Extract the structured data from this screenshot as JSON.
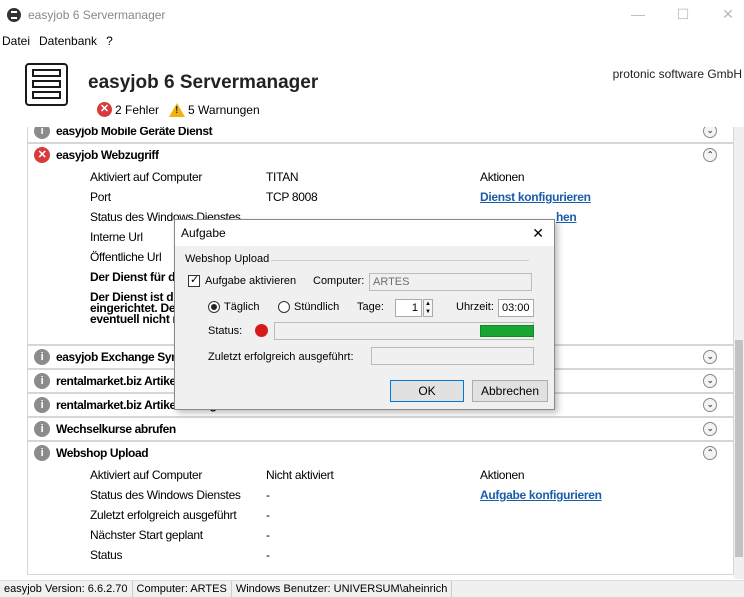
{
  "window": {
    "title": "easyjob 6 Servermanager",
    "minimize": "—",
    "maximize": "☐",
    "close": "✕"
  },
  "menu": [
    "Datei",
    "Datenbank",
    "?"
  ],
  "header": {
    "app_name": "easyjob 6 Servermanager",
    "company": "protonic software GmbH",
    "errors": "2 Fehler",
    "warnings": "5 Warnungen"
  },
  "panels": {
    "mobile": {
      "title": "easyjob Mobile Geräte Dienst"
    },
    "webzugriff": {
      "title": "easyjob Webzugriff",
      "label_aktiviert": "Aktiviert auf Computer",
      "value_aktiviert": "TITAN",
      "label_port": "Port",
      "value_port": "TCP 8008",
      "label_status": "Status des Windows Dienstes",
      "label_intern": "Interne Url",
      "label_public": "Öffentliche Url",
      "warn1": "Der Dienst für d",
      "warn2": "Der Dienst ist d",
      "warn3": "eingerichtet. De",
      "warn4": "eventuell nicht n",
      "aktionen": "Aktionen",
      "link1": "Dienst konfigurieren",
      "link2": "hen"
    },
    "exchange": {
      "title": "easyjob Exchange Syn"
    },
    "rm1": {
      "title": "rentalmarket.biz Artike"
    },
    "rm2": {
      "title": "rentalmarket.biz Artikel Verfügbarkeit veröffentlichen"
    },
    "wechsel": {
      "title": "Wechselkurse abrufen"
    },
    "webshop": {
      "title": "Webshop Upload",
      "label_aktiviert": "Aktiviert auf Computer",
      "value_aktiviert": "Nicht aktiviert",
      "label_status": "Status des Windows Dienstes",
      "value_status": "-",
      "label_zuletzt": "Zuletzt erfolgreich ausgeführt",
      "value_zuletzt": "-",
      "label_naechster": "Nächster Start geplant",
      "value_naechster": "-",
      "label_status2": "Status",
      "value_status2": "-",
      "aktionen": "Aktionen",
      "link": "Aufgabe konfigurieren"
    }
  },
  "dialog": {
    "title": "Aufgabe",
    "group": "Webshop Upload",
    "checkbox_label": "Aufgabe aktivieren",
    "computer_label": "Computer:",
    "computer_value": "ARTES",
    "daily": "Täglich",
    "hourly": "Stündlich",
    "days_label": "Tage:",
    "days_value": "1",
    "time_label": "Uhrzeit:",
    "time_value": "03:00",
    "status_label": "Status:",
    "last_label": "Zuletzt erfolgreich ausgeführt:",
    "ok": "OK",
    "cancel": "Abbrechen"
  },
  "status": {
    "version": "easyjob Version: 6.6.2.70",
    "computer": "Computer: ARTES",
    "user": "Windows Benutzer: UNIVERSUM\\aheinrich"
  },
  "colors": {
    "error": "#d83b3b",
    "warning": "#f2b10f",
    "link": "#1a5ea8",
    "ok_status": "#18a532"
  }
}
